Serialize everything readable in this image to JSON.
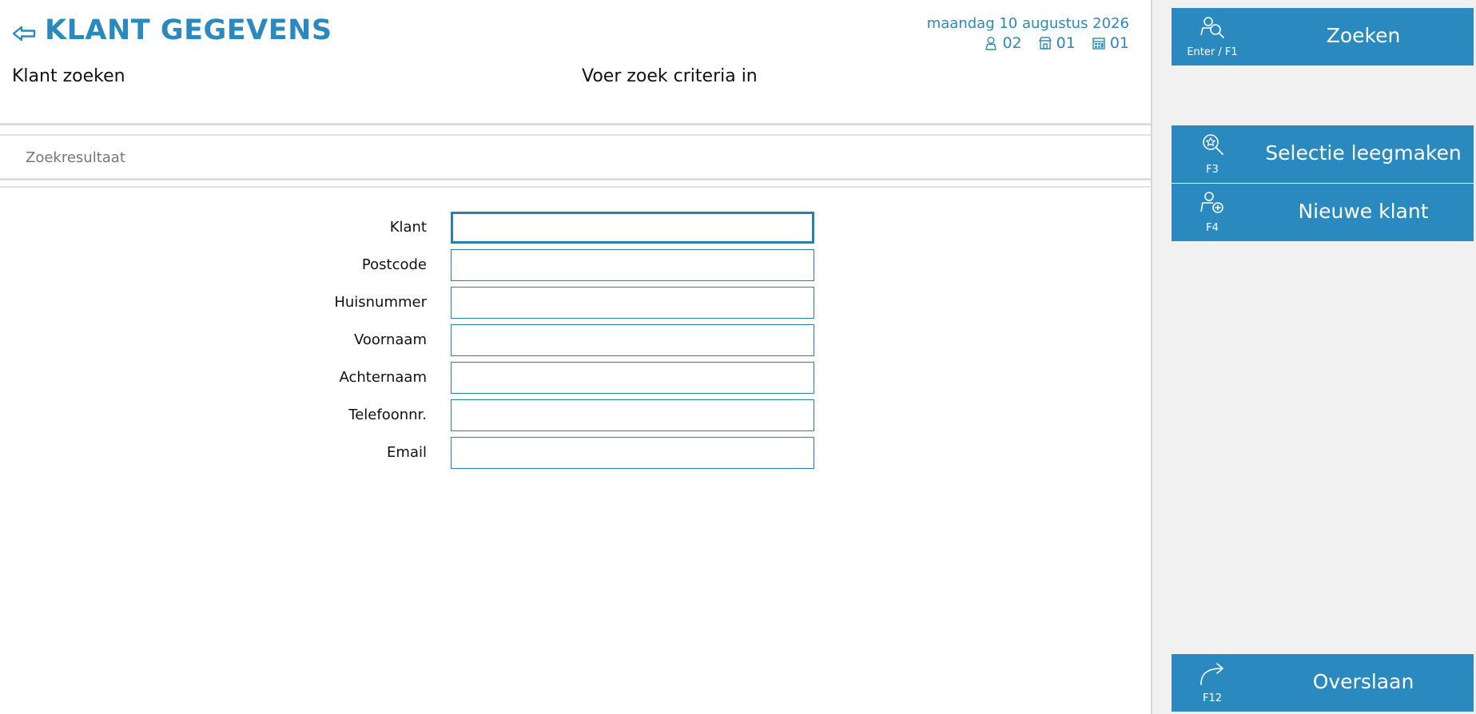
{
  "header": {
    "title": "KLANT GEGEVENS",
    "subtitle_left": "Klant zoeken",
    "subtitle_center": "Voer zoek criteria in",
    "date": "maandag 10 augustus 2026",
    "status": [
      {
        "icon": "user-icon",
        "value": "02"
      },
      {
        "icon": "store-icon",
        "value": "01"
      },
      {
        "icon": "register-icon",
        "value": "01"
      }
    ]
  },
  "results": {
    "label": "Zoekresultaat"
  },
  "form": {
    "fields": [
      {
        "label": "Klant",
        "value": ""
      },
      {
        "label": "Postcode",
        "value": ""
      },
      {
        "label": "Huisnummer",
        "value": ""
      },
      {
        "label": "Voornaam",
        "value": ""
      },
      {
        "label": "Achternaam",
        "value": ""
      },
      {
        "label": "Telefoonnr.",
        "value": ""
      },
      {
        "label": "Email",
        "value": ""
      }
    ]
  },
  "sidebar": {
    "buttons": [
      {
        "label": "Zoeken",
        "key": "Enter / F1",
        "icon": "search-user-icon"
      },
      {
        "label": "Selectie leegmaken",
        "key": "F3",
        "icon": "clear-search-icon"
      },
      {
        "label": "Nieuwe klant",
        "key": "F4",
        "icon": "add-user-icon"
      },
      {
        "label": "Overslaan",
        "key": "F12",
        "icon": "skip-arrow-icon"
      }
    ]
  },
  "colors": {
    "accent": "#2a8abf",
    "input_border": "#2a7fab",
    "sidebar_bg": "#f1f1f1"
  }
}
